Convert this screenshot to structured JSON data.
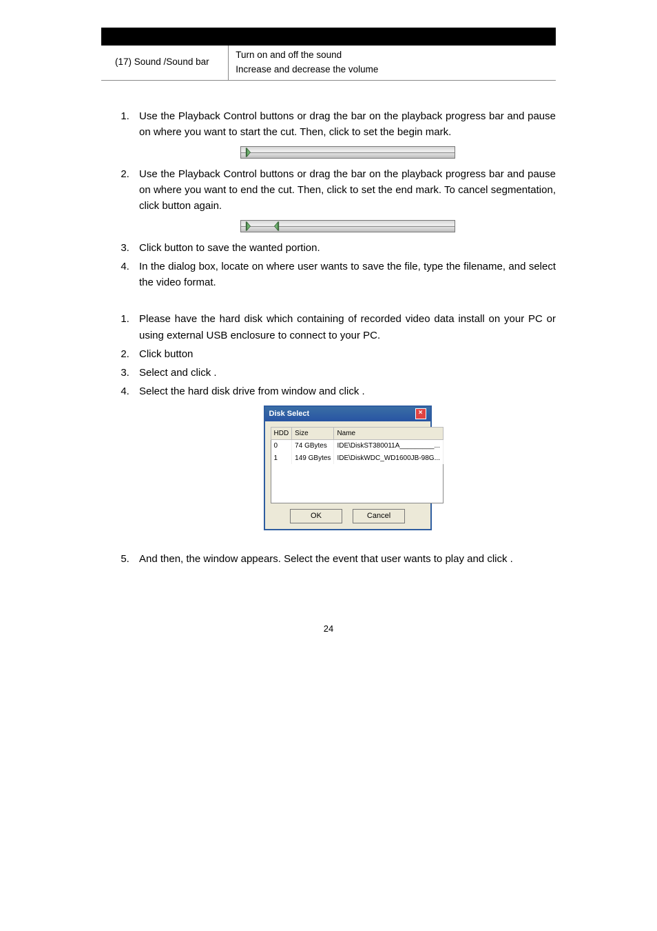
{
  "meta_table": {
    "left": "(17)  Sound /Sound bar",
    "right_line1": "Turn on and off the sound",
    "right_line2": "Increase and decrease the volume"
  },
  "section_a": [
    {
      "pre": "Use the Playback Control buttons or drag the bar on the playback progress bar and pause on where you want to start the cut. Then, click ",
      "post": " to set the begin mark."
    },
    {
      "pre": "Use the Playback Control buttons or drag the bar on the playback progress bar and pause on where you want to end the cut. Then, click ",
      "mid": " to set the end mark. To cancel segmentation, click ",
      "post": " button again."
    },
    {
      "pre": "Click ",
      "post": " button to save the wanted portion."
    },
    {
      "pre": "In the ",
      "post": " dialog box, locate on where user wants to save the file, type the filename, and select the video format."
    }
  ],
  "section_b": [
    "Please have the hard disk which containing of recorded video data install on your PC or using external USB enclosure to connect to your PC.",
    {
      "pre": "Click ",
      "post": " button"
    },
    {
      "pre": "Select ",
      "mid": " and click ",
      "post": "."
    },
    {
      "pre": "Select the hard disk drive from ",
      "mid": " window and click ",
      "post": "."
    },
    {
      "pre": "And then, the ",
      "mid": " window appears. Select the event that user wants to play and click ",
      "post": "."
    }
  ],
  "disk_dialog": {
    "title": "Disk Select",
    "headers": [
      "HDD",
      "Size",
      "Name"
    ],
    "rows": [
      [
        "0",
        "74 GBytes",
        "IDE\\DiskST380011A_________..."
      ],
      [
        "1",
        "149 GBytes",
        "IDE\\DiskWDC_WD1600JB-98G..."
      ]
    ],
    "ok": "OK",
    "cancel": "Cancel"
  },
  "page_number": "24"
}
